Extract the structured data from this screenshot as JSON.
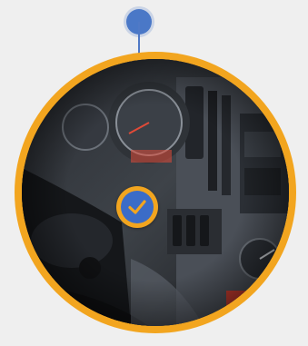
{
  "hotspot": {
    "icon": "location-pin-icon",
    "check_icon": "checkmark-icon",
    "colors": {
      "ring": "#f2a51f",
      "accent": "#3b6cc7",
      "pin": "#4a78c7",
      "background": "#efefef"
    }
  },
  "photo": {
    "subject_icon": "truck-dashboard-photo"
  }
}
